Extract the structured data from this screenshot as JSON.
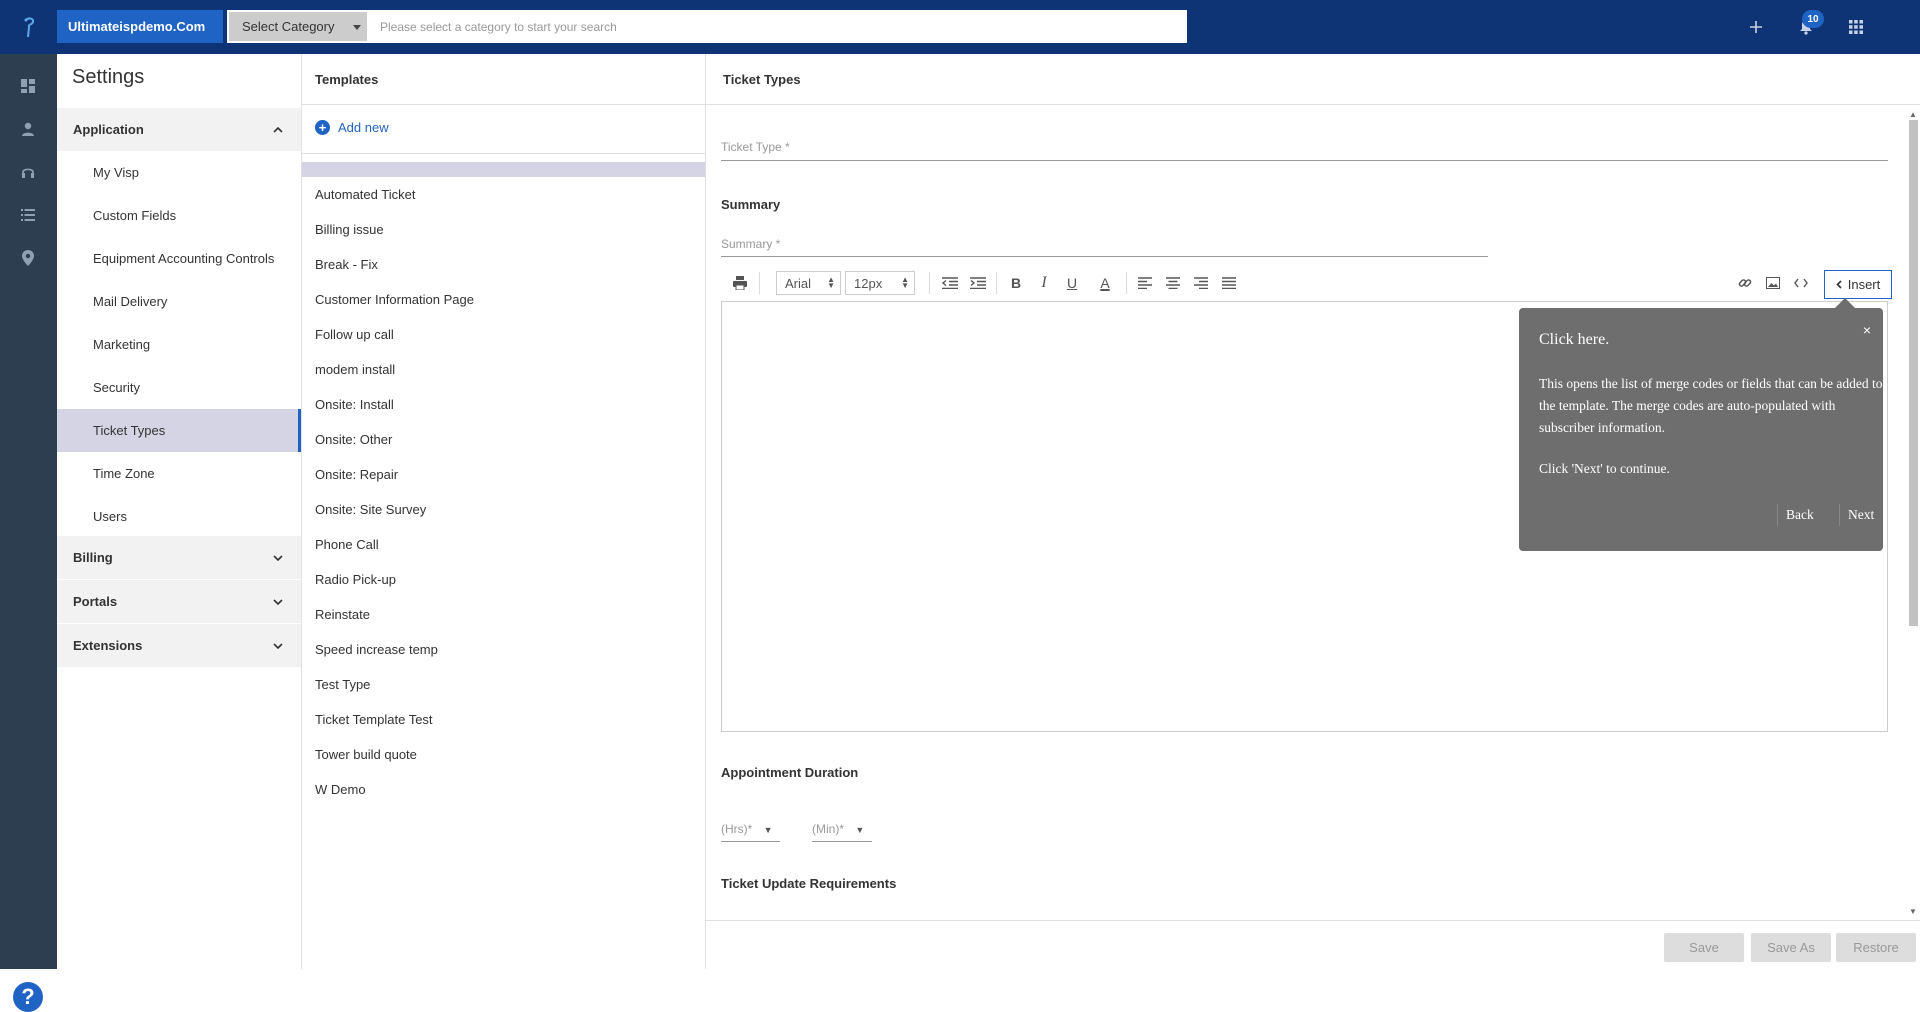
{
  "topbar": {
    "domain": "Ultimateispdemo.Com",
    "category": "Select Category",
    "search_placeholder": "Please select a category to start your search",
    "notification_count": "10"
  },
  "settings": {
    "title": "Settings",
    "application": "Application",
    "items": [
      "My Visp",
      "Custom Fields",
      "Equipment Accounting Controls",
      "Mail Delivery",
      "Marketing",
      "Security",
      "Ticket Types",
      "Time Zone",
      "Users"
    ],
    "billing": "Billing",
    "portals": "Portals",
    "extensions": "Extensions"
  },
  "templates": {
    "title": "Templates",
    "add_new": "Add new",
    "items": [
      "Automated Ticket",
      "Billing issue",
      "Break - Fix",
      "Customer Information Page",
      "Follow up call",
      "modem install",
      "Onsite: Install",
      "Onsite: Other",
      "Onsite: Repair",
      "Onsite: Site Survey",
      "Phone Call",
      "Radio Pick-up",
      "Reinstate",
      "Speed increase temp",
      "Test Type",
      "Ticket Template Test",
      "Tower build quote",
      "W Demo"
    ]
  },
  "main": {
    "title": "Ticket Types",
    "ticket_type_label": "Ticket Type *",
    "summary_heading": "Summary",
    "summary_label": "Summary *",
    "font": "Arial",
    "size": "12px",
    "insert": "Insert",
    "appointment_heading": "Appointment Duration",
    "hrs": "(Hrs)*",
    "min": "(Min)*",
    "requirements_heading": "Ticket Update Requirements",
    "save": "Save",
    "save_as": "Save As",
    "restore": "Restore"
  },
  "tour": {
    "close": "×",
    "title": "Click here.",
    "body": "This opens the list of merge codes or fields that can be added to the template. The merge codes are auto-populated with subscriber information.",
    "continue": "Click 'Next' to continue.",
    "back": "Back",
    "next": "Next"
  },
  "colors": {
    "topbar": "#0f3475",
    "accent": "#1f63c4",
    "rail": "#2d3e50",
    "selected": "#d4d4e4",
    "tour_bg": "#6e6e6e"
  },
  "icons": [
    "logo-icon",
    "plus-icon",
    "bell-icon",
    "apps-grid-icon",
    "dashboard-icon",
    "user-icon",
    "headset-icon",
    "list-icon",
    "location-pin-icon",
    "help-icon",
    "print-icon",
    "outdent-icon",
    "indent-icon",
    "bold-icon",
    "italic-icon",
    "underline-icon",
    "text-color-icon",
    "align-left-icon",
    "align-center-icon",
    "align-right-icon",
    "justify-icon",
    "link-icon",
    "image-icon",
    "code-icon"
  ]
}
